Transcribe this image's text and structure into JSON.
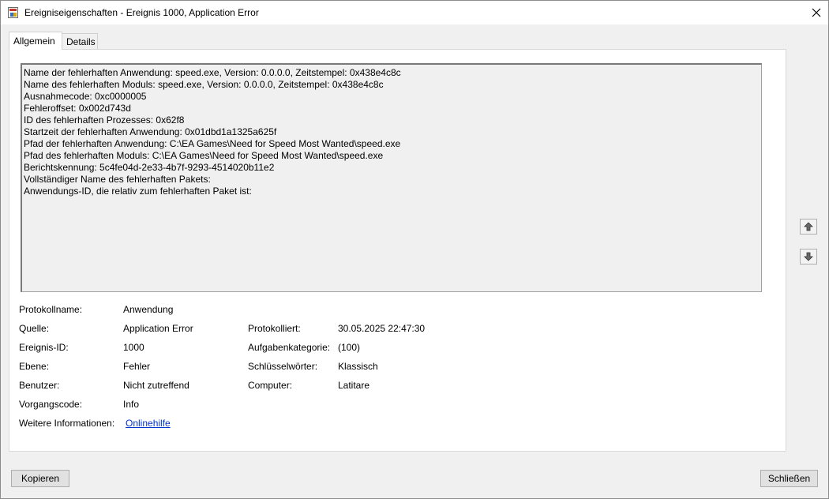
{
  "window": {
    "title": "Ereigniseigenschaften - Ereignis 1000, Application Error"
  },
  "tabs": [
    {
      "label": "Allgemein",
      "active": true
    },
    {
      "label": "Details",
      "active": false
    }
  ],
  "description_lines": [
    "Name der fehlerhaften Anwendung: speed.exe, Version: 0.0.0.0, Zeitstempel: 0x438e4c8c",
    "Name des fehlerhaften Moduls: speed.exe, Version: 0.0.0.0, Zeitstempel: 0x438e4c8c",
    "Ausnahmecode: 0xc0000005",
    "Fehleroffset: 0x002d743d",
    "ID des fehlerhaften Prozesses: 0x62f8",
    "Startzeit der fehlerhaften Anwendung: 0x01dbd1a1325a625f",
    "Pfad der fehlerhaften Anwendung: C:\\EA Games\\Need for Speed Most Wanted\\speed.exe",
    "Pfad des fehlerhaften Moduls: C:\\EA Games\\Need for Speed Most Wanted\\speed.exe",
    "Berichtskennung: 5c4fe04d-2e33-4b7f-9293-4514020b11e2",
    "Vollständiger Name des fehlerhaften Pakets:",
    "Anwendungs-ID, die relativ zum fehlerhaften Paket ist:"
  ],
  "properties": {
    "protokollname": {
      "label": "Protokollname:",
      "value": "Anwendung"
    },
    "quelle": {
      "label": "Quelle:",
      "value": "Application Error"
    },
    "protokolliert": {
      "label": "Protokolliert:",
      "value": "30.05.2025 22:47:30"
    },
    "ereignis_id": {
      "label": "Ereignis-ID:",
      "value": "1000"
    },
    "aufgabenkategorie": {
      "label": "Aufgabenkategorie:",
      "value": "(100)"
    },
    "ebene": {
      "label": "Ebene:",
      "value": "Fehler"
    },
    "schluesselwoerter": {
      "label": "Schlüsselwörter:",
      "value": "Klassisch"
    },
    "benutzer": {
      "label": "Benutzer:",
      "value": "Nicht zutreffend"
    },
    "computer": {
      "label": "Computer:",
      "value": "Latitare"
    },
    "vorgangscode": {
      "label": "Vorgangscode:",
      "value": "Info"
    },
    "weitere_informationen": {
      "label": "Weitere Informationen:",
      "value": "Onlinehilfe"
    }
  },
  "buttons": {
    "copy": "Kopieren",
    "close": "Schließen"
  },
  "icons": {
    "app": "event-viewer-icon",
    "close": "close-icon",
    "up": "arrow-up-icon",
    "down": "arrow-down-icon"
  }
}
